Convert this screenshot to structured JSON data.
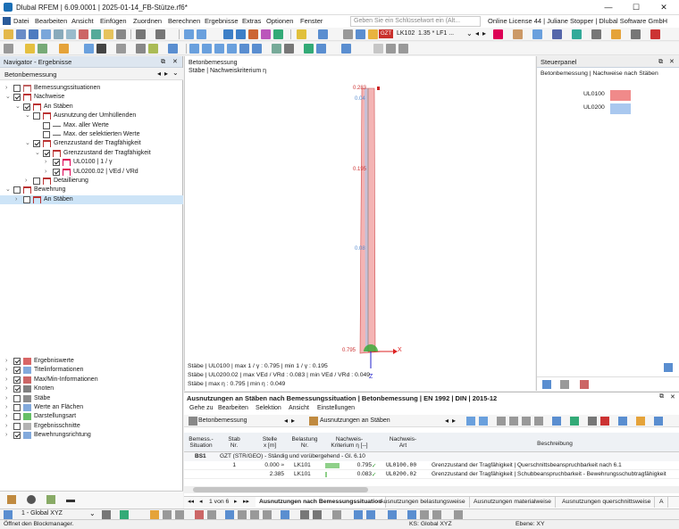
{
  "window": {
    "title": "Dlubal RFEM | 6.09.0001 | 2025-01-14_FB-Stütze.rf6*",
    "minimize": "—",
    "maximize": "☐",
    "close": "✕"
  },
  "menu": {
    "items": [
      "Datei",
      "Bearbeiten",
      "Ansicht",
      "Einfügen",
      "Zuordnen",
      "Berechnen",
      "Ergebnisse",
      "Extras",
      "Optionen",
      "Fenster"
    ],
    "search_placeholder": "Geben Sie ein Schlüsselwort ein (Alt...",
    "license": "Online License 44 | Juliane Stopper | Dlubal Software GmbH"
  },
  "toolbar": {
    "gzt_badge": "GZT",
    "load_combo": "LK102",
    "combo_desc": "1.35 * LF1 ..."
  },
  "navigator": {
    "title": "Navigator - Ergebnisse",
    "dropdown": "Betonbemessung",
    "tree": [
      {
        "label": "Bemessungssituationen",
        "level": 0,
        "checked": false,
        "expand": "›"
      },
      {
        "label": "Nachweise",
        "level": 0,
        "checked": true,
        "expand": "⌄"
      },
      {
        "label": "An Stäben",
        "level": 1,
        "checked": true,
        "expand": "⌄"
      },
      {
        "label": "Ausnutzung der Umhüllenden",
        "level": 2,
        "checked": false,
        "expand": "⌄"
      },
      {
        "label": "Max. aller Werte",
        "level": 3,
        "checked": false,
        "expand": ""
      },
      {
        "label": "Max. der selektierten Werte",
        "level": 3,
        "checked": false,
        "expand": ""
      },
      {
        "label": "Grenzzustand der Tragfähigkeit",
        "level": 2,
        "checked": true,
        "expand": "⌄"
      },
      {
        "label": "Grenzzustand der Tragfähigkeit",
        "level": 3,
        "checked": true,
        "expand": "⌄"
      },
      {
        "label": "UL0100 | 1 / γ",
        "level": 4,
        "checked": true,
        "expand": "›"
      },
      {
        "label": "UL0200.02 | VEd / VRd",
        "level": 4,
        "checked": true,
        "expand": "›"
      },
      {
        "label": "Detaillierung",
        "level": 2,
        "checked": false,
        "expand": "›"
      },
      {
        "label": "Bewehrung",
        "level": 0,
        "checked": false,
        "expand": "⌄"
      },
      {
        "label": "An Stäben",
        "level": 1,
        "checked": false,
        "expand": "›",
        "selected": true
      }
    ],
    "display_options": [
      {
        "label": "Ergebniswerte",
        "checked": true
      },
      {
        "label": "Titelinformationen",
        "checked": true
      },
      {
        "label": "Max/Min-Informationen",
        "checked": true
      },
      {
        "label": "Knoten",
        "checked": true
      },
      {
        "label": "Stäbe",
        "checked": false
      },
      {
        "label": "Werte an Flächen",
        "checked": false
      },
      {
        "label": "Darstellungsart",
        "checked": false
      },
      {
        "label": "Ergebnisschnitte",
        "checked": false
      },
      {
        "label": "Bewehrungsrichtung",
        "checked": true
      }
    ],
    "view_combo": "1 - Global XYZ"
  },
  "viewport": {
    "header_line1": "Betonbemessung",
    "header_line2": "Stäbe | Nachweiskriterium η",
    "labels": {
      "top": "0.283",
      "v1": "0.04",
      "v2": "0.195",
      "v3": "0.08",
      "bottom": "0.795"
    },
    "axis_x": "X",
    "axis_z": "Z",
    "footer1": "Stäbe | UL0100 | max 1 / γ : 0.795 | min 1 / γ : 0.195",
    "footer2": "Stäbe | UL0200.02 | max VEd / VRd : 0.083 | min VEd / VRd : 0.049",
    "footer3": "Stäbe | max η : 0.795 | min η : 0.049"
  },
  "control_panel": {
    "title": "Steuerpanel",
    "subtitle": "Betonbemessung | Nachweise nach Stäben",
    "legend": [
      {
        "label": "UL0100",
        "color": "#f08a8a"
      },
      {
        "label": "UL0200",
        "color": "#a9c8ef"
      }
    ]
  },
  "results": {
    "title": "Ausnutzungen an Stäben nach Bemessungssituation | Betonbemessung | EN 1992 | DIN | 2015-12",
    "menu": [
      "Gehe zu",
      "Bearbeiten",
      "Selektion",
      "Ansicht",
      "Einstellungen"
    ],
    "combo1": "Betonbemessung",
    "combo2": "Ausnutzungen an Stäben",
    "headers": {
      "situation": "Bemess.-\nSituation",
      "stab": "Stab\nNr.",
      "stelle": "Stelle\nx [m]",
      "belastung": "Belastung\nNr.",
      "kriterium": "Nachweis-\nKriterium η [--]",
      "art": "Nachweis-\nArt",
      "beschreibung": "Beschreibung"
    },
    "group_label": "BS1",
    "group_desc": "GZT (STR/GEO) - Ständig und vorübergehend - Gl. 6.10",
    "rows": [
      {
        "stab": "1",
        "stelle": "0.000 ≈",
        "belastung": "LK101",
        "eta": "0.795",
        "eta_frac": 0.795,
        "check": "✓",
        "art": "UL0100.00",
        "desc": "Grenzzustand der Tragfähigkeit | Querschnittsbeanspruchbarkeit nach 6.1"
      },
      {
        "stab": "",
        "stelle": "2.385",
        "belastung": "LK101",
        "eta": "0.083",
        "eta_frac": 0.083,
        "check": "✓",
        "art": "UL0200.02",
        "desc": "Grenzzustand der Tragfähigkeit | Schubbeanspruchbarkeit - Bewehrungsschubtragfähigkeit"
      }
    ],
    "pager": "1 von 6",
    "tabs": [
      "Ausnutzungen nach Bemessungssituation",
      "Ausnutzungen belastungsweise",
      "Ausnutzungen materialweise",
      "Ausnutzungen querschnittsweise",
      "A"
    ]
  },
  "status": {
    "message": "Öffnet den Blockmanager.",
    "ks": "KS: Global XYZ",
    "plane": "Ebene: XY"
  }
}
